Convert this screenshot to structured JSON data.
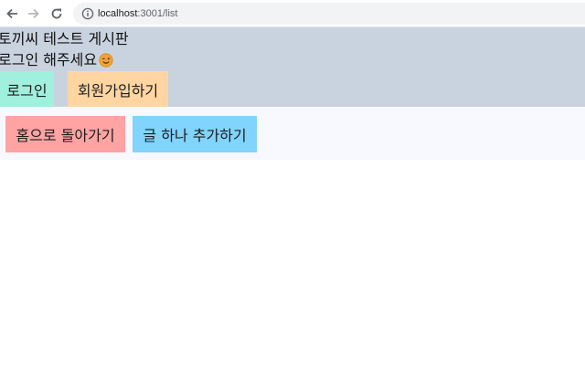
{
  "browser": {
    "url_host": "localhost",
    "url_rest": ":3001/list",
    "icons": [
      "back-arrow-icon",
      "forward-arrow-icon",
      "reload-icon",
      "info-icon"
    ]
  },
  "header": {
    "site_title": "토끼씨 테스트 게시판",
    "login_notice": "로그인 해주세요",
    "login_button": "로그인",
    "signup_button": "회원가입하기",
    "icons": [
      "winking-face-icon",
      "crescent-moon-icon"
    ]
  },
  "nav": {
    "home_button": "홈으로 돌아가기",
    "add_post_button": "글 하나 추가하기"
  },
  "colors": {
    "header_bg": "#c9d3df",
    "nav_bg": "#f8f9ff",
    "login_bg": "#9ff0dc",
    "signup_bg": "#ffd5a2",
    "home_bg": "#ffa3a3",
    "add_bg": "#81d4fb"
  }
}
